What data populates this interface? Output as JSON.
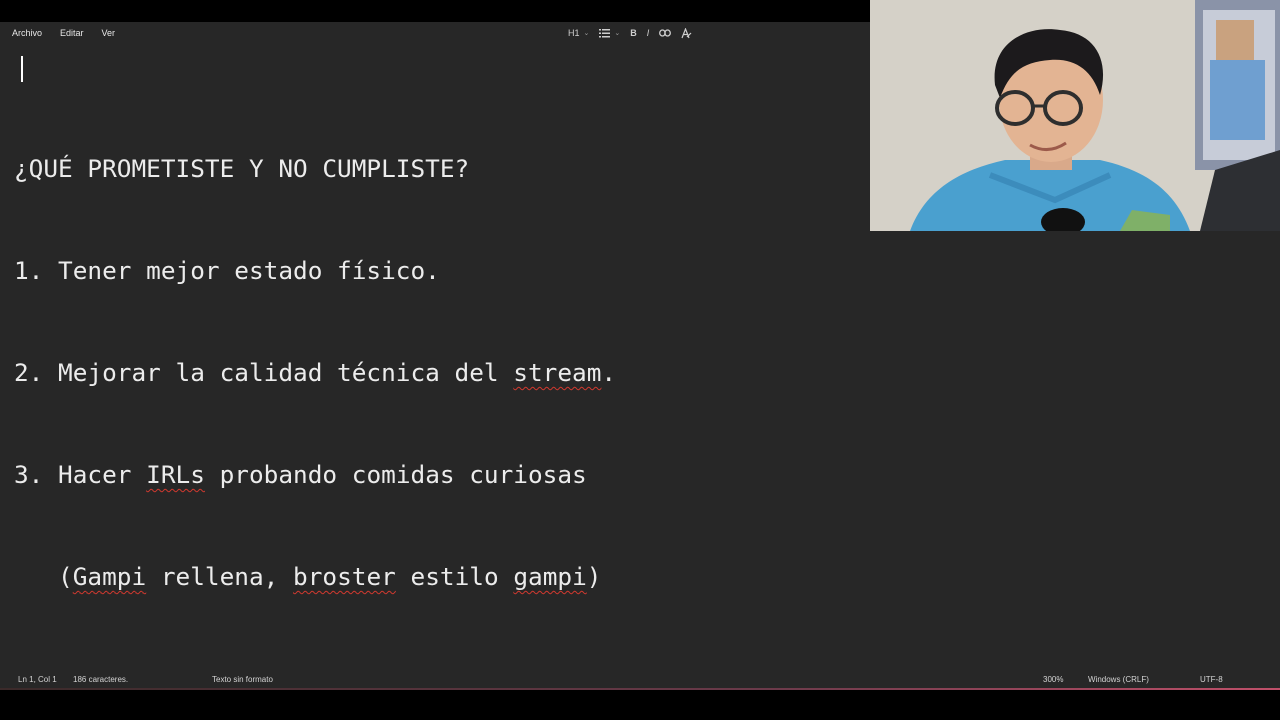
{
  "menu": {
    "file": "Archivo",
    "edit": "Editar",
    "view": "Ver"
  },
  "toolbar": {
    "heading": "H1",
    "list_icon": "list-icon",
    "bold": "B",
    "italic": "I",
    "link_icon": "link-icon",
    "clear_format_icon": "clear-formatting-icon"
  },
  "document": {
    "lines": [
      "¿QUÉ PROMETISTE Y NO CUMPLISTE?",
      "1. Tener mejor estado físico.",
      "2. Mejorar la calidad técnica del stream.",
      "3. Hacer IRLs probando comidas curiosas",
      "   (Gampi rellena, broster estilo gampi)"
    ]
  },
  "status": {
    "cursor": "Ln 1, Col 1",
    "chars": "186 caracteres.",
    "format": "Texto sin formato",
    "zoom": "300%",
    "line_ending": "Windows (CRLF)",
    "encoding": "UTF-8"
  },
  "colors": {
    "editor_bg": "#272727",
    "text": "#ececec",
    "spellcheck": "#d2392f"
  }
}
